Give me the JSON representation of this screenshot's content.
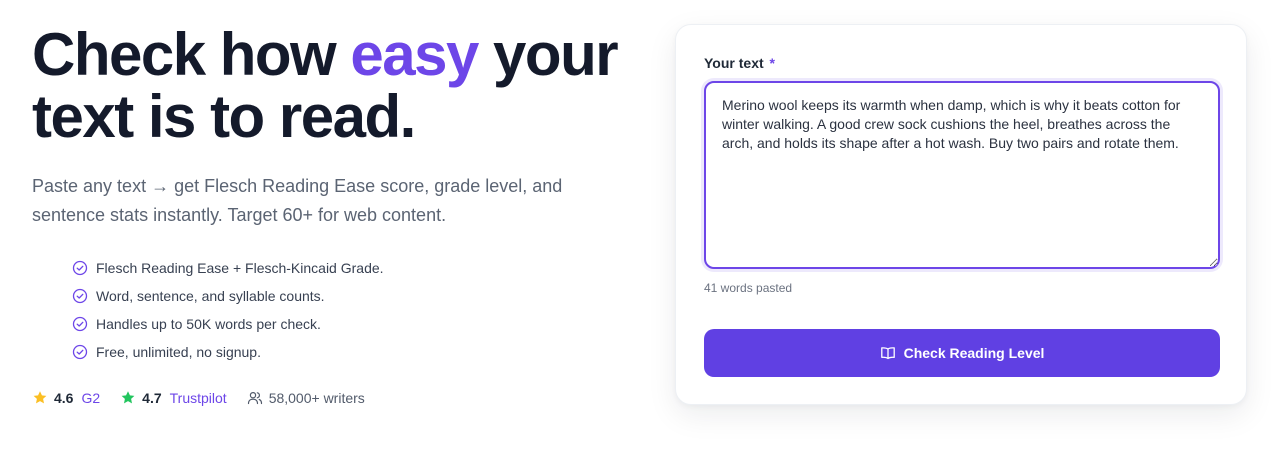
{
  "hero": {
    "headline_before": "Check how ",
    "headline_accent": "easy",
    "headline_after": " your text is to read.",
    "subhead": "Paste any text → get Flesch Reading Ease score, grade level, and sentence stats instantly. Target 60+ for web content.",
    "features": [
      "Flesch Reading Ease + Flesch-Kincaid Grade.",
      "Word, sentence, and syllable counts.",
      "Handles up to 50K words per check.",
      "Free, unlimited, no signup."
    ]
  },
  "ratings": {
    "g2": {
      "score": "4.6",
      "source": "G2",
      "star_color": "#fbbf24"
    },
    "trustpilot": {
      "score": "4.7",
      "source": "Trustpilot",
      "star_color": "#22c55e"
    },
    "writers": "58,000+ writers"
  },
  "form": {
    "label": "Your text",
    "required_mark": "*",
    "text_value": "Merino wool keeps its warmth when damp, which is why it beats cotton for winter walking. A good crew sock cushions the heel, breathes across the arch, and holds its shape after a hot wash. Buy two pairs and rotate them.",
    "word_count": "41 words pasted",
    "submit_label": "Check Reading Level"
  },
  "colors": {
    "accent": "#6d46e8",
    "button": "#6040e3",
    "headline": "#141a2b"
  },
  "icons": {
    "feature": "check-circle-icon",
    "rating": "star-icon",
    "writers": "users-icon",
    "button": "book-open-icon"
  }
}
